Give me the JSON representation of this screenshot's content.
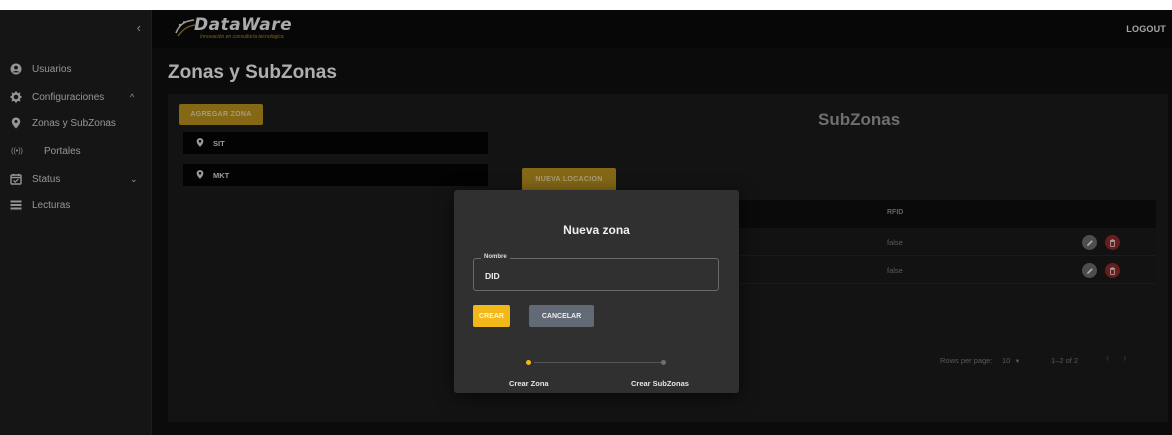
{
  "app": {
    "brand": "DataWare",
    "tagline": "Innovación en consultoría tecnológica",
    "logout_label": "LOGOUT",
    "collapse_glyph": "‹"
  },
  "sidebar": {
    "items": [
      {
        "label": "Usuarios",
        "icon": "user-circle-icon"
      },
      {
        "label": "Configuraciones",
        "icon": "gear-icon",
        "chevron": "^"
      },
      {
        "label": "Zonas y SubZonas",
        "icon": "map-pin-icon"
      },
      {
        "label": "Portales",
        "icon": "radio-waves-icon",
        "glyph": "((•))"
      },
      {
        "label": "Status",
        "icon": "calendar-check-icon",
        "chevron": "⌄"
      },
      {
        "label": "Lecturas",
        "icon": "list-icon"
      }
    ]
  },
  "page": {
    "title": "Zonas y SubZonas",
    "add_zone_label": "AGREGAR ZONA",
    "zones": [
      {
        "label": "SIT"
      },
      {
        "label": "MKT"
      }
    ]
  },
  "subzones": {
    "title": "SubZonas",
    "new_location_label": "NUEVA LOCACION",
    "columns": {
      "rfid": "RFID"
    },
    "rows": [
      {
        "rfid": "false"
      },
      {
        "rfid": "false"
      }
    ],
    "pagination": {
      "rows_per_page_label": "Rows per page:",
      "rows_per_page_value": "10",
      "range": "1–2 of 2",
      "prev_glyph": "‹",
      "next_glyph": "›"
    }
  },
  "modal": {
    "title": "Nueva zona",
    "field_label": "Nombre",
    "field_value": "DID",
    "create_label": "CREAR",
    "cancel_label": "CANCELAR",
    "steps": [
      {
        "label": "Crear Zona",
        "active": true
      },
      {
        "label": "Crear SubZonas",
        "active": false
      }
    ]
  },
  "colors": {
    "accent": "#f2b81a",
    "accent_dim": "#b8911f",
    "delete": "#8e2a2a",
    "cancel": "#616a75",
    "background": "#101010"
  }
}
